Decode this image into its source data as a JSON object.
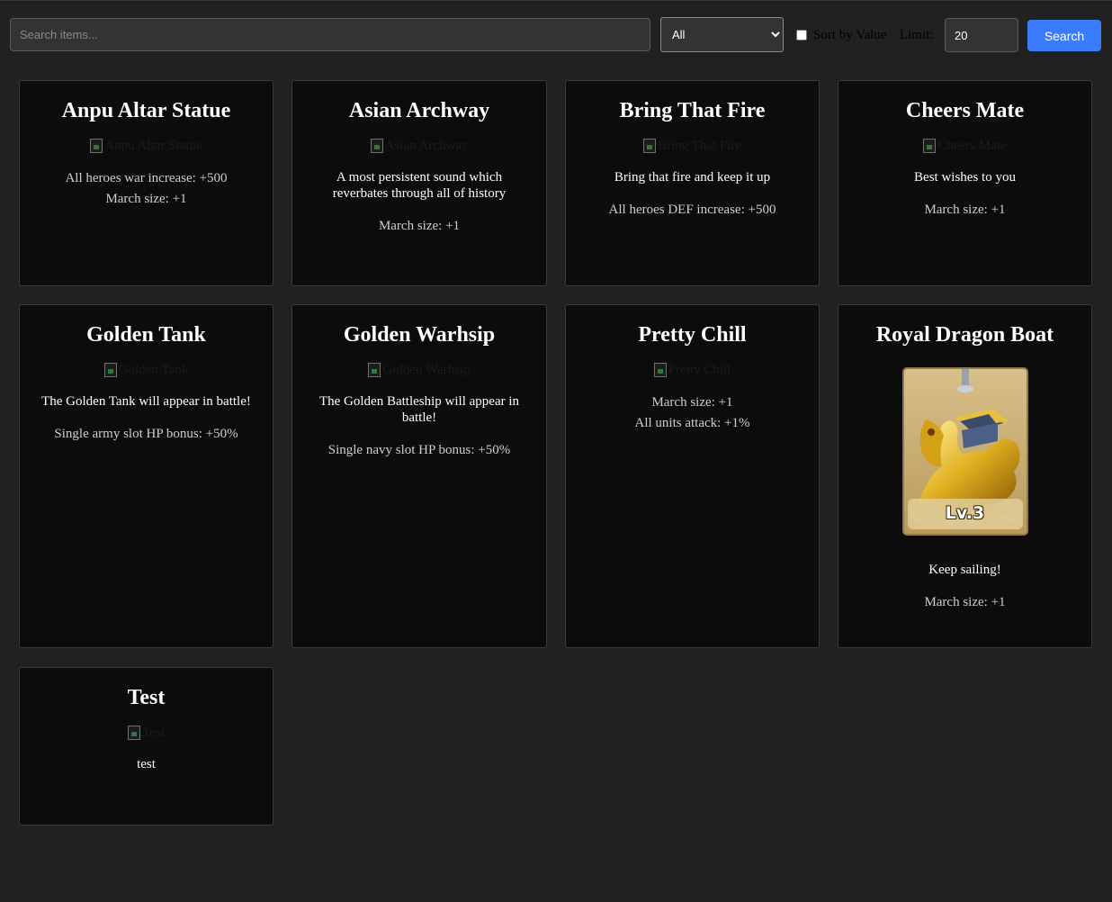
{
  "search": {
    "placeholder": "Search items..."
  },
  "filter": {
    "selected": "All"
  },
  "sort": {
    "label": "Sort by Value",
    "checked": false
  },
  "limit": {
    "label": "Limit:",
    "value": "20"
  },
  "search_button": {
    "label": "Search"
  },
  "colors": {
    "background": "#212121",
    "card": "#0c0c0c",
    "accent": "#3b7cff"
  },
  "cards": [
    {
      "title": "Anpu Altar Statue",
      "alt": "Anpu Altar Statue",
      "description": "",
      "stats": [
        "All heroes war increase: +500",
        "March size: +1"
      ]
    },
    {
      "title": "Asian Archway",
      "alt": "Asian Archway",
      "description": "A most persistent sound which reverbates through all of history",
      "stats": [
        "March size: +1"
      ]
    },
    {
      "title": "Bring That Fire",
      "alt": "Bring That Fire",
      "description": "Bring that fire and keep it up",
      "stats": [
        "All heroes DEF increase: +500"
      ]
    },
    {
      "title": "Cheers Mate",
      "alt": "Cheers Mate",
      "description": "Best wishes to you",
      "stats": [
        "March size: +1"
      ]
    },
    {
      "title": "Golden Tank",
      "alt": "Golden Tank",
      "description": "The Golden Tank will appear in battle!",
      "stats": [
        "Single army slot HP bonus: +50%"
      ]
    },
    {
      "title": "Golden Warhsip",
      "alt": "Golden Warhsip",
      "description": "The Golden Battleship will appear in battle!",
      "stats": [
        "Single navy slot HP bonus: +50%"
      ]
    },
    {
      "title": "Pretty Chill",
      "alt": "Pretty Chill",
      "description": "",
      "stats": [
        "March size: +1",
        "All units attack: +1%"
      ]
    },
    {
      "title": "Royal Dragon Boat",
      "level": "Lv.3",
      "description": "Keep sailing!",
      "stats": [
        "March size: +1"
      ]
    },
    {
      "title": "Test",
      "alt": "Test",
      "description": "test",
      "stats": []
    }
  ]
}
